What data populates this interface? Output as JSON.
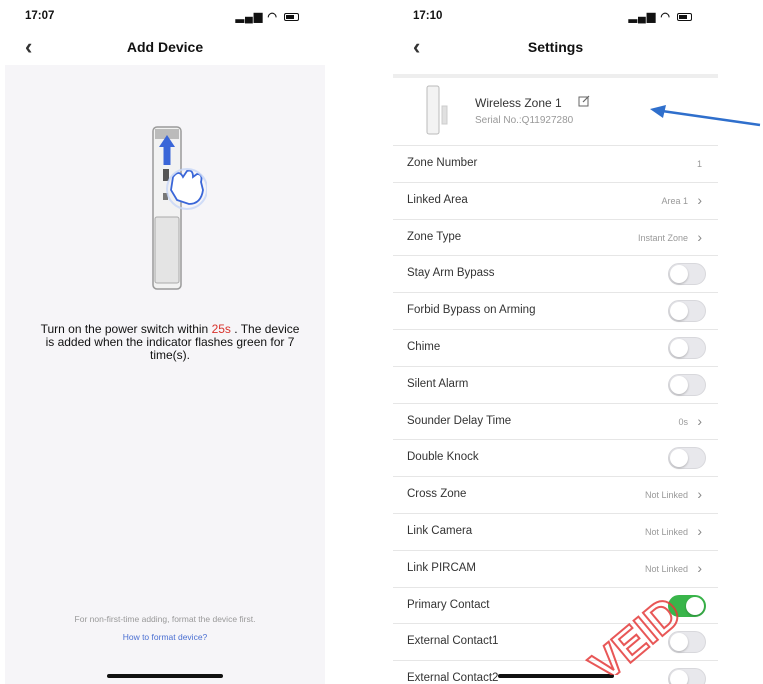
{
  "left": {
    "status_time": "17:07",
    "title": "Add Device",
    "instruction_pre": "Turn on the power switch within ",
    "countdown": "25s",
    "instruction_post": " . The device is added when the indicator flashes green for 7 time(s).",
    "footer_note": "For non-first-time adding, format the device first.",
    "footer_link": "How to format device?"
  },
  "right": {
    "status_time": "17:10",
    "title": "Settings",
    "device": {
      "name": "Wireless Zone 1",
      "serial": "Serial No.:Q11927280"
    },
    "rows": [
      {
        "label": "Zone Number",
        "value": "1",
        "chevron": false
      },
      {
        "label": "Linked Area",
        "value": "Area 1",
        "chevron": true
      },
      {
        "label": "Zone Type",
        "value": "Instant Zone",
        "chevron": true
      },
      {
        "label": "Stay Arm Bypass",
        "toggle": false
      },
      {
        "label": "Forbid Bypass on Arming",
        "toggle": false
      },
      {
        "label": "Chime",
        "toggle": false
      },
      {
        "label": "Silent Alarm",
        "toggle": false
      },
      {
        "label": "Sounder Delay Time",
        "value": "0s",
        "chevron": true
      },
      {
        "label": "Double Knock",
        "toggle": false
      },
      {
        "label": "Cross Zone",
        "value": "Not Linked",
        "chevron": true
      },
      {
        "label": "Link Camera",
        "value": "Not Linked",
        "chevron": true
      },
      {
        "label": "Link PIRCAM",
        "value": "Not Linked",
        "chevron": true
      },
      {
        "label": "Primary Contact",
        "toggle": true
      },
      {
        "label": "External Contact1",
        "toggle": false
      },
      {
        "label": "External Contact2",
        "toggle": false
      }
    ]
  },
  "stamp_text": "VEID",
  "colors": {
    "accent_red": "#d8322c",
    "toggle_on": "#39b54a",
    "link_blue": "#4a6fd2",
    "arrow_blue": "#2f6fcc"
  }
}
